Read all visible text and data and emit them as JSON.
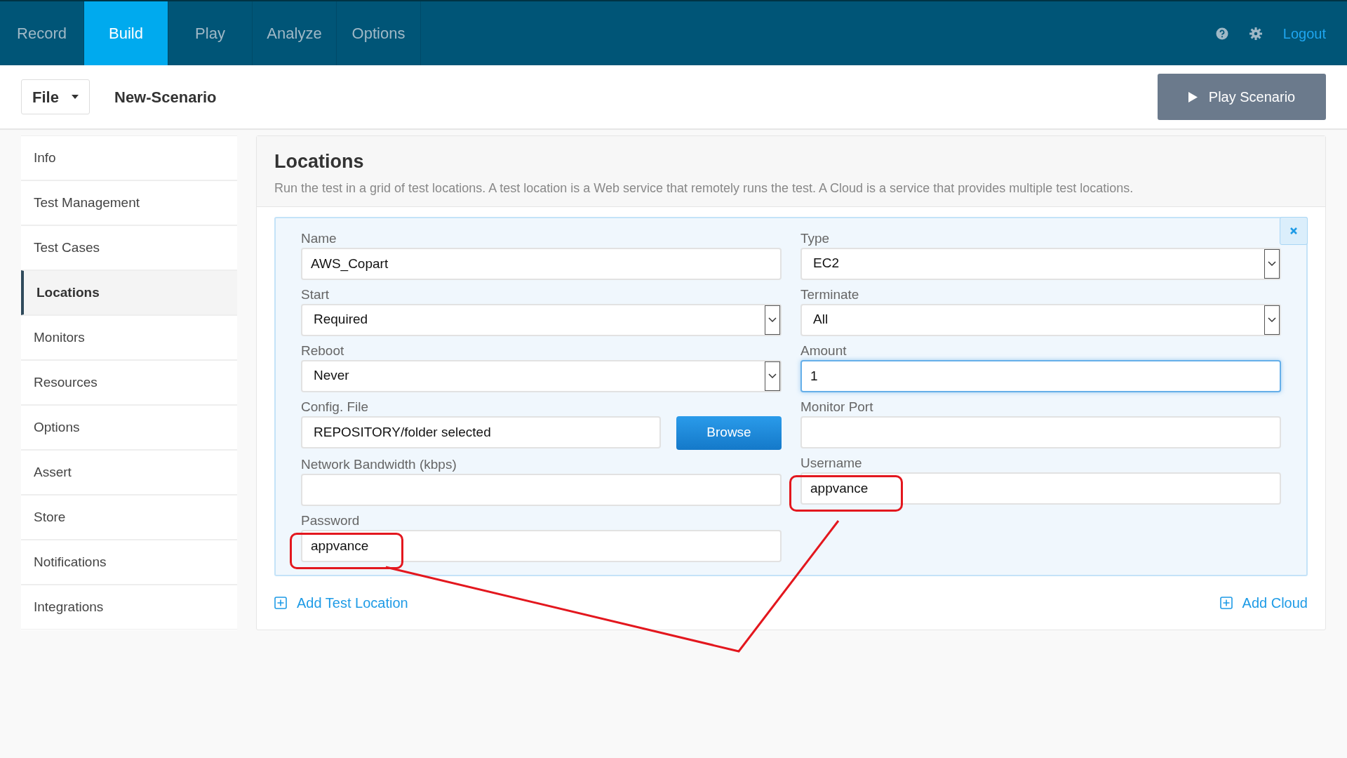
{
  "nav": {
    "tabs": [
      {
        "label": "Record",
        "selected": false
      },
      {
        "label": "Build",
        "selected": true
      },
      {
        "label": "Play",
        "selected": false
      },
      {
        "label": "Analyze",
        "selected": false
      },
      {
        "label": "Options",
        "selected": false
      }
    ],
    "logout": "Logout"
  },
  "toolbar": {
    "file_menu": "File",
    "scenario_name": "New-Scenario",
    "play_button": "Play Scenario"
  },
  "sidebar": {
    "items": [
      {
        "label": "Info",
        "selected": false
      },
      {
        "label": "Test Management",
        "selected": false
      },
      {
        "label": "Test Cases",
        "selected": false
      },
      {
        "label": "Locations",
        "selected": true
      },
      {
        "label": "Monitors",
        "selected": false
      },
      {
        "label": "Resources",
        "selected": false
      },
      {
        "label": "Options",
        "selected": false
      },
      {
        "label": "Assert",
        "selected": false
      },
      {
        "label": "Store",
        "selected": false
      },
      {
        "label": "Notifications",
        "selected": false
      },
      {
        "label": "Integrations",
        "selected": false
      }
    ]
  },
  "panel": {
    "title": "Locations",
    "description": "Run the test in a grid of test locations. A test location is a Web service that remotely runs the test. A Cloud is a service that provides multiple test locations.",
    "form": {
      "left": [
        {
          "kind": "text",
          "label": "Name",
          "value": "AWS_Copart",
          "focused": false,
          "circled": false
        },
        {
          "kind": "select",
          "label": "Start",
          "value": "Required",
          "focused": false,
          "circled": false
        },
        {
          "kind": "select",
          "label": "Reboot",
          "value": "Never",
          "focused": false,
          "circled": false
        },
        {
          "kind": "file",
          "label": "Config. File",
          "value": "REPOSITORY/folder selected",
          "button": "Browse",
          "focused": false,
          "circled": false
        },
        {
          "kind": "text",
          "label": "Network Bandwidth (kbps)",
          "focused": false,
          "circled": false
        },
        {
          "kind": "text",
          "label": "Password",
          "value": "appvance",
          "focused": false,
          "circled": true
        }
      ],
      "right": [
        {
          "kind": "select",
          "label": "Type",
          "value": "EC2",
          "focused": false,
          "circled": false
        },
        {
          "kind": "select",
          "label": "Terminate",
          "value": "All",
          "focused": false,
          "circled": false
        },
        {
          "kind": "text",
          "label": "Amount",
          "value": "1",
          "focused": true,
          "circled": false
        },
        {
          "kind": "text",
          "label": "Monitor Port",
          "focused": false,
          "circled": false
        },
        {
          "kind": "text",
          "label": "Username",
          "value": "appvance",
          "focused": false,
          "circled": true
        }
      ]
    },
    "add_location": "Add Test Location",
    "add_cloud": "Add Cloud"
  }
}
